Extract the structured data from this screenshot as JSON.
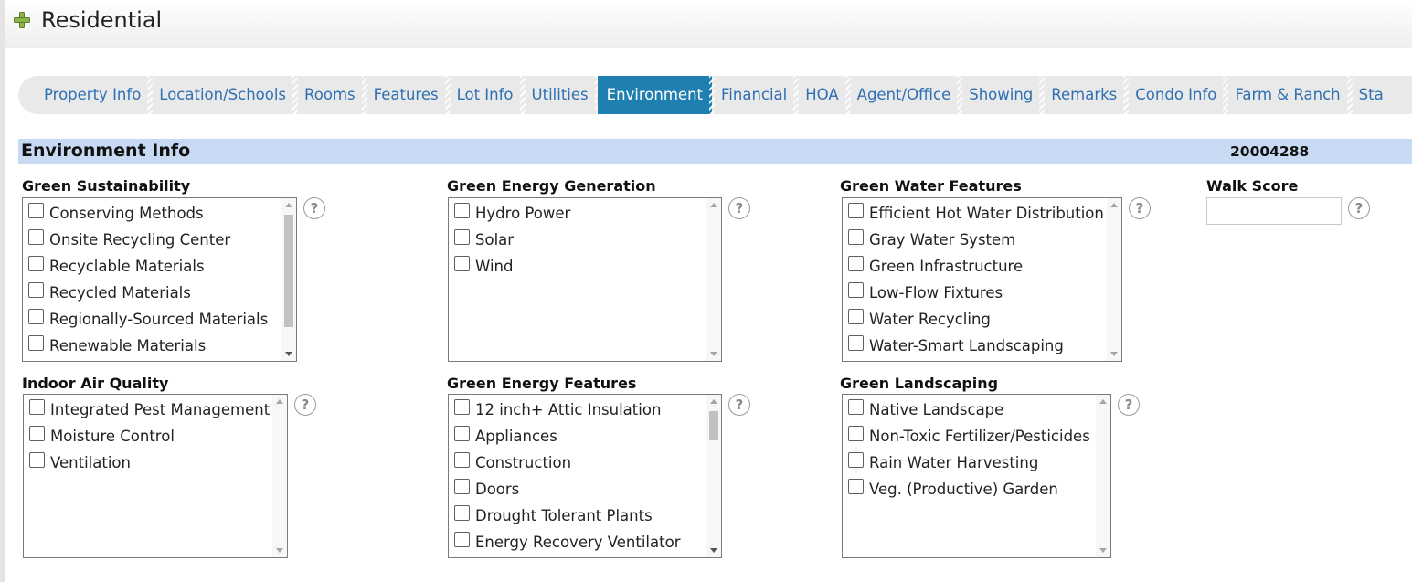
{
  "header": {
    "title": "Residential",
    "icon": "plus-icon"
  },
  "tabs": [
    {
      "label": "Property Info"
    },
    {
      "label": "Location/Schools"
    },
    {
      "label": "Rooms"
    },
    {
      "label": "Features"
    },
    {
      "label": "Lot Info"
    },
    {
      "label": "Utilities"
    },
    {
      "label": "Environment",
      "active": true
    },
    {
      "label": "Financial"
    },
    {
      "label": "HOA"
    },
    {
      "label": "Agent/Office"
    },
    {
      "label": "Showing"
    },
    {
      "label": "Remarks"
    },
    {
      "label": "Condo Info"
    },
    {
      "label": "Farm & Ranch"
    },
    {
      "label": "Sta"
    }
  ],
  "section": {
    "title": "Environment Info",
    "id": "20004288"
  },
  "groups": {
    "green_sustainability": {
      "label": "Green Sustainability",
      "options": [
        "Conserving Methods",
        "Onsite Recycling Center",
        "Recyclable Materials",
        "Recycled Materials",
        "Regionally-Sourced Materials",
        "Renewable Materials"
      ]
    },
    "green_energy_generation": {
      "label": "Green Energy Generation",
      "options": [
        "Hydro Power",
        "Solar",
        "Wind"
      ]
    },
    "green_water_features": {
      "label": "Green Water Features",
      "options": [
        "Efficient Hot Water Distribution",
        "Gray Water System",
        "Green Infrastructure",
        "Low-Flow Fixtures",
        "Water Recycling",
        "Water-Smart Landscaping"
      ]
    },
    "indoor_air_quality": {
      "label": "Indoor Air Quality",
      "options": [
        "Integrated Pest Management",
        "Moisture Control",
        "Ventilation"
      ]
    },
    "green_energy_features": {
      "label": "Green Energy Features",
      "options": [
        "12 inch+ Attic Insulation",
        "Appliances",
        "Construction",
        "Doors",
        "Drought Tolerant Plants",
        "Energy Recovery Ventilator"
      ]
    },
    "green_landscaping": {
      "label": "Green Landscaping",
      "options": [
        "Native Landscape",
        "Non-Toxic Fertilizer/Pesticides",
        "Rain Water Harvesting",
        "Veg. (Productive) Garden"
      ]
    }
  },
  "walk_score": {
    "label": "Walk Score",
    "value": ""
  },
  "help_icon_glyph": "?",
  "colors": {
    "active_tab": "#1f7fb0",
    "tab_text": "#2e6fb3",
    "section_bar": "#c8daf3"
  }
}
